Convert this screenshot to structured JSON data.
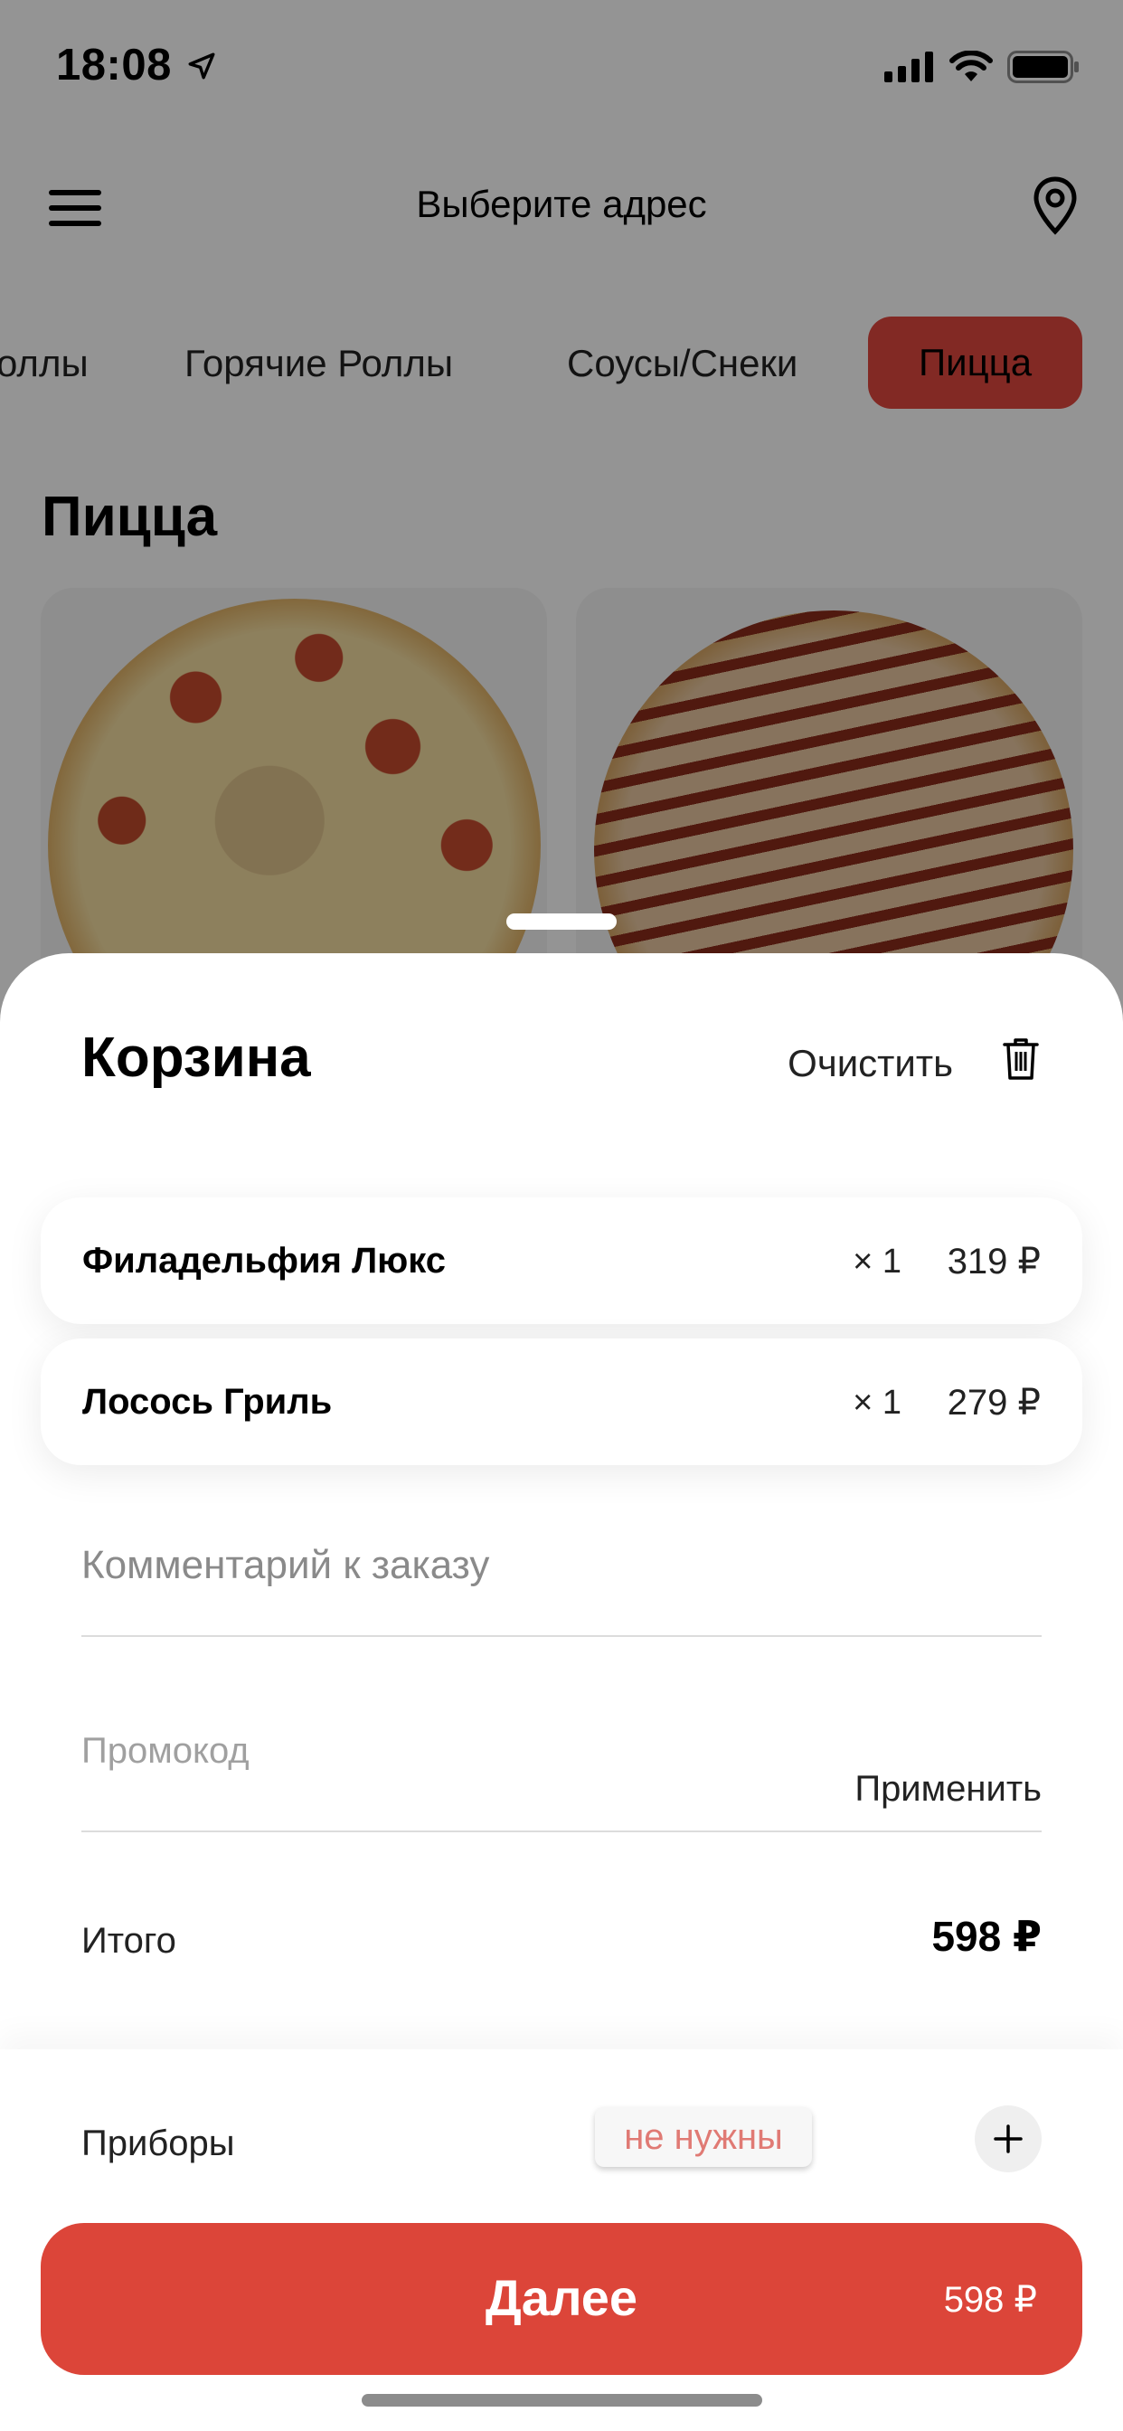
{
  "status_bar": {
    "time": "18:08"
  },
  "header": {
    "address_prompt": "Выберите адрес"
  },
  "categories": {
    "items": [
      "оллы",
      "Горячие Роллы",
      "Соусы/Снеки"
    ],
    "active": "Пицца"
  },
  "section": {
    "title": "Пицца"
  },
  "cart": {
    "title": "Корзина",
    "clear_label": "Очистить",
    "items": [
      {
        "name": "Филадельфия Люкс",
        "qty": "× 1",
        "price": "319 ₽"
      },
      {
        "name": "Лосось Гриль",
        "qty": "× 1",
        "price": "279 ₽"
      }
    ],
    "comment_placeholder": "Комментарий к заказу",
    "promo_placeholder": "Промокод",
    "apply_label": "Применить",
    "total_label": "Итого",
    "total_value": "598 ₽",
    "cutlery_label": "Приборы",
    "cutlery_value": "не нужны",
    "next_label": "Далее",
    "next_price": "598 ₽"
  },
  "colors": {
    "accent": "#dc4539",
    "cutlery_text": "#e07a74"
  }
}
